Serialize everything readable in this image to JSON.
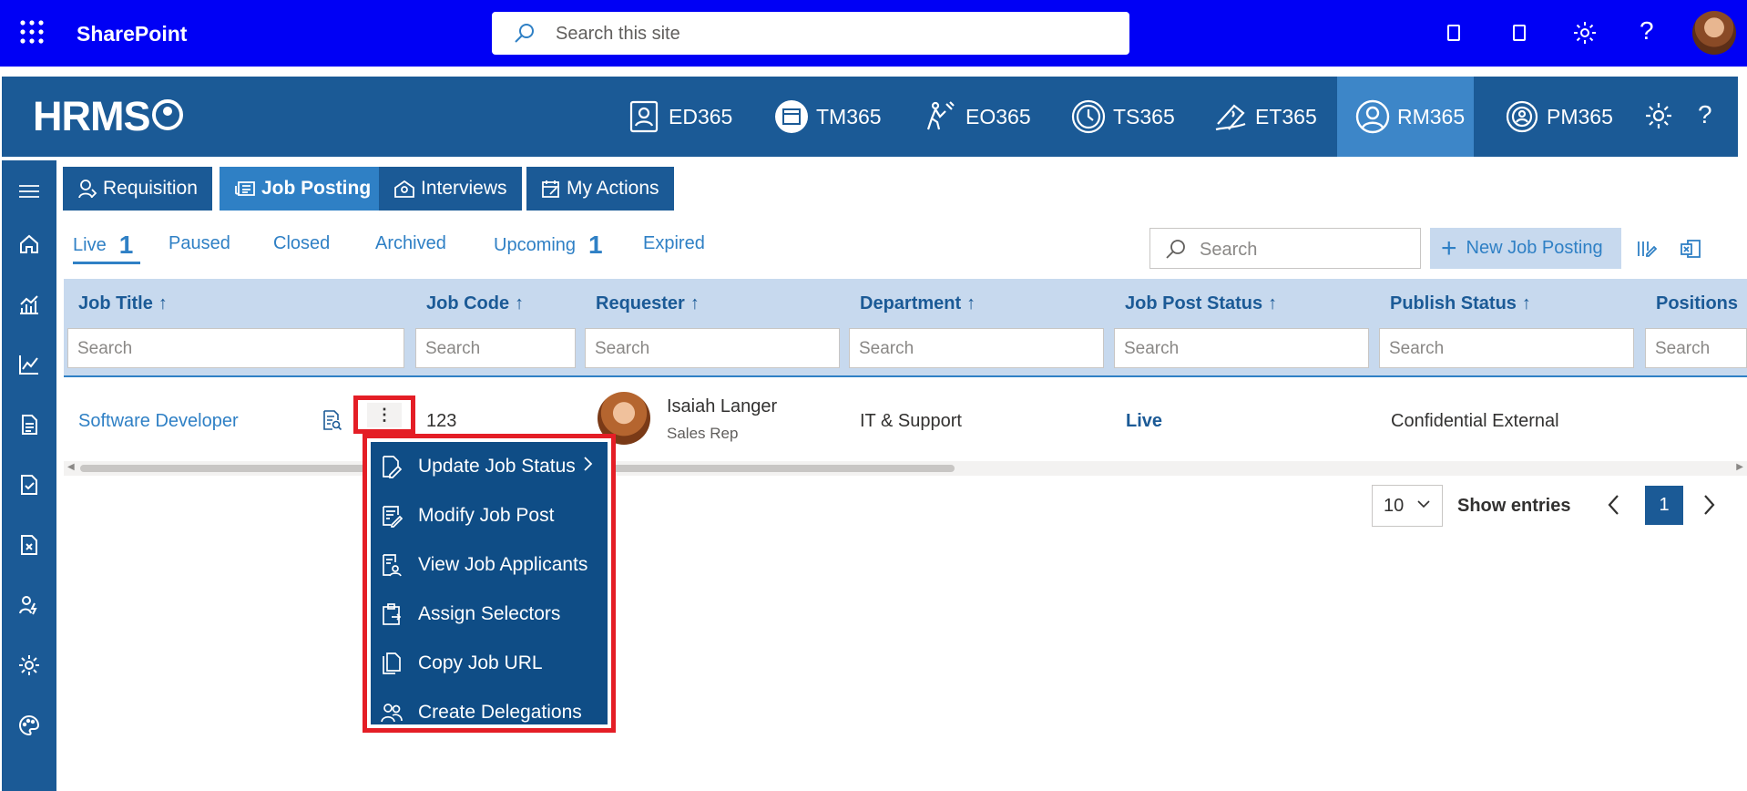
{
  "suitebar": {
    "app_name": "SharePoint",
    "search_placeholder": "Search this site"
  },
  "appbar": {
    "logo": "HRMS",
    "nav": [
      {
        "label": "ED365",
        "icon": "employee-directory-icon"
      },
      {
        "label": "TM365",
        "icon": "calendar-icon"
      },
      {
        "label": "EO365",
        "icon": "onboarding-icon"
      },
      {
        "label": "TS365",
        "icon": "clock-icon"
      },
      {
        "label": "ET365",
        "icon": "expense-icon"
      },
      {
        "label": "RM365",
        "icon": "recruitment-icon",
        "active": true
      },
      {
        "label": "PM365",
        "icon": "performance-icon"
      }
    ]
  },
  "module_tabs": [
    {
      "label": "Requisition"
    },
    {
      "label": "Job Posting",
      "active": true
    },
    {
      "label": "Interviews"
    },
    {
      "label": "My Actions"
    }
  ],
  "sub_tabs": {
    "live": {
      "label": "Live",
      "count": "1"
    },
    "paused": {
      "label": "Paused"
    },
    "closed": {
      "label": "Closed"
    },
    "archived": {
      "label": "Archived"
    },
    "upcoming": {
      "label": "Upcoming",
      "count": "1"
    },
    "expired": {
      "label": "Expired"
    }
  },
  "toolbar": {
    "search_placeholder": "Search",
    "new_button": "New Job Posting"
  },
  "table": {
    "columns": [
      {
        "label": "Job Title",
        "sort": "↑"
      },
      {
        "label": "Job Code",
        "sort": "↑"
      },
      {
        "label": "Requester",
        "sort": "↑"
      },
      {
        "label": "Department",
        "sort": "↑"
      },
      {
        "label": "Job Post Status",
        "sort": "↑"
      },
      {
        "label": "Publish Status",
        "sort": "↑"
      },
      {
        "label": "Positions",
        "sort": ""
      }
    ],
    "filter_placeholder": "Search",
    "rows": [
      {
        "job_title": "Software Developer",
        "kebab": "⋮",
        "job_code": "123",
        "requester_name": "Isaiah Langer",
        "requester_role": "Sales Rep",
        "department": "IT & Support",
        "job_post_status": "Live",
        "publish_status": "Confidential External"
      }
    ]
  },
  "pagination": {
    "page_size": "10",
    "show_entries": "Show entries",
    "current_page": "1"
  },
  "context_menu": {
    "items": [
      {
        "label": "Update Job Status",
        "icon": "edit-page-icon",
        "submenu": true
      },
      {
        "label": "Modify Job Post",
        "icon": "form-edit-icon"
      },
      {
        "label": "View Job Applicants",
        "icon": "applicants-icon"
      },
      {
        "label": "Assign Selectors",
        "icon": "clipboard-assign-icon"
      },
      {
        "label": "Copy Job URL",
        "icon": "copy-icon"
      },
      {
        "label": "Create Delegations",
        "icon": "people-icon"
      }
    ]
  },
  "colors": {
    "suitebar": "#0000f5",
    "app_header": "#1b5a96",
    "accent": "#2f80c5",
    "highlight_border": "#e41e26",
    "menu_bg": "#0f4d86"
  }
}
